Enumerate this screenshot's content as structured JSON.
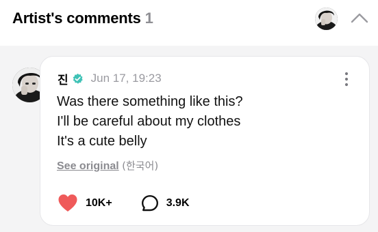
{
  "header": {
    "title": "Artist's comments",
    "count": "1",
    "collapse_icon": "chevron-up-icon"
  },
  "comment": {
    "author": "진",
    "verified_icon": "verified-badge-icon",
    "timestamp": "Jun 17, 19:23",
    "lines": [
      "Was there something like this?",
      "I'll be careful about my clothes",
      "It's a cute belly"
    ],
    "see_original": "See original",
    "original_language": "(한국어)",
    "likes": "10K+",
    "replies": "3.9K",
    "like_icon": "heart-icon",
    "reply_icon": "speech-bubble-icon",
    "more_icon": "more-vertical-icon"
  },
  "colors": {
    "heart": "#ef5a5a",
    "verified": "#3fc2b6",
    "muted_text": "#8b8b90",
    "background": "#f4f4f5"
  }
}
